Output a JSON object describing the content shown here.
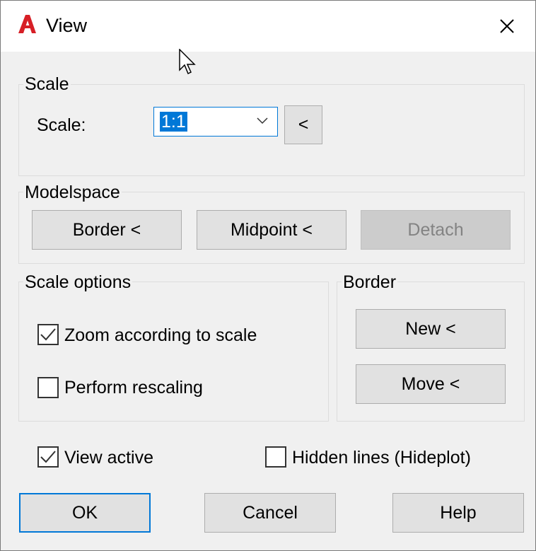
{
  "window": {
    "title": "View",
    "app_icon": "autocad-logo-icon",
    "close_icon": "close-icon"
  },
  "scale_group": {
    "label": "Scale",
    "scale_label": "Scale:",
    "scale_value": "1:1",
    "pick_button": "<"
  },
  "modelspace_group": {
    "label": "Modelspace",
    "border_button": "Border <",
    "midpoint_button": "Midpoint <",
    "detach_button": "Detach"
  },
  "scale_options_group": {
    "label": "Scale options",
    "zoom_label": "Zoom according to scale",
    "zoom_checked": true,
    "rescale_label": "Perform rescaling",
    "rescale_checked": false
  },
  "border_group": {
    "label": "Border",
    "new_button": "New <",
    "move_button": "Move <"
  },
  "bottom": {
    "view_active_label": "View active",
    "view_active_checked": true,
    "hidden_lines_label": "Hidden lines (Hideplot)",
    "hidden_lines_checked": false
  },
  "buttons": {
    "ok": "OK",
    "cancel": "Cancel",
    "help": "Help"
  },
  "colors": {
    "accent": "#0078d7",
    "logo": "#d71f26"
  }
}
